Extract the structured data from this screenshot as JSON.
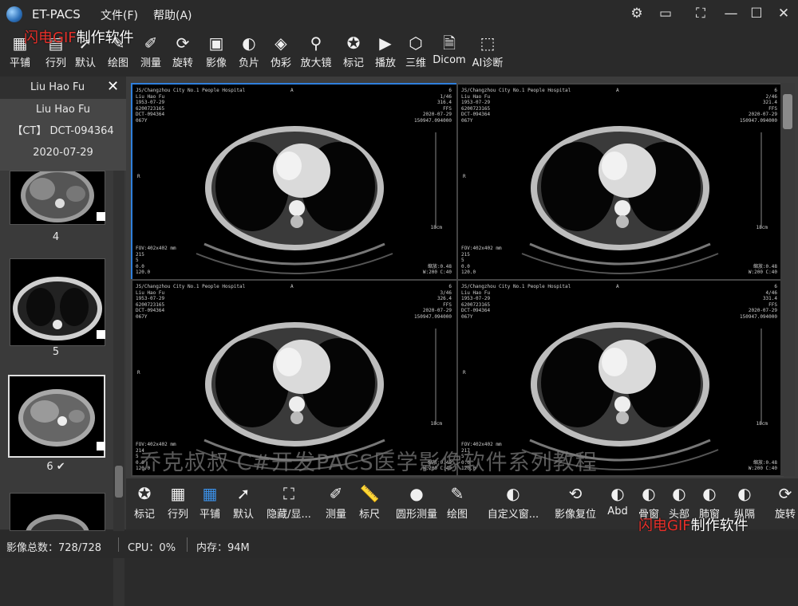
{
  "app": {
    "title": "ET-PACS",
    "menus": [
      "文件(F)",
      "帮助(A)"
    ]
  },
  "window_controls": [
    {
      "name": "settings-icon",
      "glyph": "⚙"
    },
    {
      "name": "monitor-icon",
      "glyph": "▭"
    },
    {
      "name": "fullscreen-icon",
      "glyph": "⛶"
    },
    {
      "name": "minimize-icon",
      "glyph": "—"
    },
    {
      "name": "maximize-icon",
      "glyph": "☐"
    },
    {
      "name": "close-icon",
      "glyph": "✕"
    }
  ],
  "toolbar": [
    {
      "label": "平铺",
      "icon": "tile-icon",
      "glyph": "▦"
    },
    {
      "label": "行列",
      "icon": "grid-icon",
      "glyph": "▤"
    },
    {
      "label": "默认",
      "icon": "pointer-icon",
      "glyph": "➚"
    },
    {
      "label": "绘图",
      "icon": "pencil-icon",
      "glyph": "✎"
    },
    {
      "label": "测量",
      "icon": "ruler-icon",
      "glyph": "✐"
    },
    {
      "label": "旋转",
      "icon": "rotate-icon",
      "glyph": "⟳"
    },
    {
      "label": "影像",
      "icon": "dicom-image-icon",
      "glyph": "▣"
    },
    {
      "label": "负片",
      "icon": "negative-icon",
      "glyph": "◐"
    },
    {
      "label": "伪彩",
      "icon": "paint-bucket-icon",
      "glyph": "◈"
    },
    {
      "label": "放大镜",
      "icon": "magnifier-icon",
      "glyph": "⚲"
    },
    {
      "label": "标记",
      "icon": "mark-icon",
      "glyph": "✪"
    },
    {
      "label": "播放",
      "icon": "play-icon",
      "glyph": "▶"
    },
    {
      "label": "三维",
      "icon": "cube-icon",
      "glyph": "⬡"
    },
    {
      "label": "Dicom",
      "icon": "dicom-file-icon",
      "glyph": "🗎"
    },
    {
      "label": "AI诊断",
      "icon": "ai-icon",
      "glyph": "⬚"
    }
  ],
  "watermark": {
    "red": "闪电GIF",
    "white": "制作软件"
  },
  "patient": {
    "tab_name": "Liu Hao Fu",
    "name": "Liu Hao Fu",
    "modality": "【CT】",
    "id": "DCT-094364",
    "date": "2020-07-29"
  },
  "thumbnails": [
    {
      "number": "4",
      "checked": false
    },
    {
      "number": "5",
      "checked": false
    },
    {
      "number": "6",
      "checked": true,
      "check_mark": "✔"
    },
    {
      "number": "",
      "checked": false
    }
  ],
  "viewports": [
    {
      "hospital": "JS/Changzhou City No.1 People Hospital",
      "orient_top": "A",
      "series": "6",
      "name": "Liu Hao Fu",
      "image_index": "1/46",
      "birth": "1953-07-29",
      "position": "316.4",
      "patient_code": "6200723165",
      "pos_mode": "FFS",
      "study": "DCT-094364",
      "date": "2020-07-29",
      "age": "067Y",
      "time": "150947.094000",
      "orient_left": "R",
      "scale": "18cm",
      "fov": "FOV:402x402 mm",
      "slice": "215",
      "thickness": "5",
      "zero": "0.0",
      "kv": "120.0",
      "zoom": "缩放:0.48",
      "window": "W:200 C:40",
      "active": true
    },
    {
      "hospital": "JS/Changzhou City No.1 People Hospital",
      "orient_top": "A",
      "series": "6",
      "name": "Liu Hao Fu",
      "image_index": "2/46",
      "birth": "1953-07-29",
      "position": "321.4",
      "patient_code": "6200723165",
      "pos_mode": "FFS",
      "study": "DCT-094364",
      "date": "2020-07-29",
      "age": "067Y",
      "time": "150947.094000",
      "orient_left": "R",
      "scale": "18cm",
      "fov": "FOV:402x402 mm",
      "slice": "215",
      "thickness": "5",
      "zero": "0.0",
      "kv": "120.0",
      "zoom": "缩放:0.48",
      "window": "W:200 C:40",
      "active": false
    },
    {
      "hospital": "JS/Changzhou City No.1 People Hospital",
      "orient_top": "A",
      "series": "6",
      "name": "Liu Hao Fu",
      "image_index": "3/46",
      "birth": "1953-07-29",
      "position": "326.4",
      "patient_code": "6200723165",
      "pos_mode": "FFS",
      "study": "DCT-094364",
      "date": "2020-07-29",
      "age": "067Y",
      "time": "150947.094000",
      "orient_left": "R",
      "scale": "18cm",
      "fov": "FOV:402x402 mm",
      "slice": "214",
      "thickness": "5",
      "zero": "0.0",
      "kv": "120.0",
      "zoom": "缩放:0.48",
      "window": "W:200 C:40",
      "active": false
    },
    {
      "hospital": "JS/Changzhou City No.1 People Hospital",
      "orient_top": "A",
      "series": "6",
      "name": "Liu Hao Fu",
      "image_index": "4/46",
      "birth": "1953-07-29",
      "position": "331.4",
      "patient_code": "6200723165",
      "pos_mode": "FFS",
      "study": "DCT-094364",
      "date": "2020-07-29",
      "age": "067Y",
      "time": "150947.094000",
      "orient_left": "R",
      "scale": "18cm",
      "fov": "FOV:402x402 mm",
      "slice": "217",
      "thickness": "5",
      "zero": "0.0",
      "kv": "120.0",
      "zoom": "缩放:0.48",
      "window": "W:200 C:40",
      "active": false
    }
  ],
  "subtitle": "乔克叔叔 C#开发PACS医学影像软件系列教程",
  "bottom_toolbar": [
    {
      "label": "标记",
      "icon": "mark-icon",
      "glyph": "✪"
    },
    {
      "label": "行列",
      "icon": "grid-icon",
      "glyph": "▦"
    },
    {
      "label": "平铺",
      "icon": "tile-icon",
      "glyph": "▦",
      "selected": true
    },
    {
      "label": "默认",
      "icon": "pointer-icon",
      "glyph": "➚"
    },
    {
      "label": "隐藏/显...",
      "icon": "hide-show-icon",
      "glyph": "⛶"
    },
    {
      "label": "测量",
      "icon": "ruler-icon",
      "glyph": "✐"
    },
    {
      "label": "标尺",
      "icon": "scale-ruler-icon",
      "glyph": "📏"
    },
    {
      "label": "圆形测量",
      "icon": "circle-measure-icon",
      "glyph": "●"
    },
    {
      "label": "绘图",
      "icon": "pencil-icon",
      "glyph": "✎"
    },
    {
      "label": "自定义窗...",
      "icon": "window-level-icon",
      "glyph": "◐"
    },
    {
      "label": "影像复位",
      "icon": "reset-icon",
      "glyph": "⟲"
    },
    {
      "label": "Abd",
      "icon": "abd-window-icon",
      "glyph": "◐"
    },
    {
      "label": "骨窗",
      "icon": "bone-window-icon",
      "glyph": "◐"
    },
    {
      "label": "头部",
      "icon": "head-window-icon",
      "glyph": "◐"
    },
    {
      "label": "肺窗",
      "icon": "lung-window-icon",
      "glyph": "◐"
    },
    {
      "label": "纵隔",
      "icon": "mediastinum-window-icon",
      "glyph": "◐"
    },
    {
      "label": "旋转",
      "icon": "rotate-icon",
      "glyph": "⟳"
    }
  ],
  "status": {
    "images": "影像总数：728/728",
    "cpu": "CPU：0%",
    "memory": "内存：94M"
  }
}
